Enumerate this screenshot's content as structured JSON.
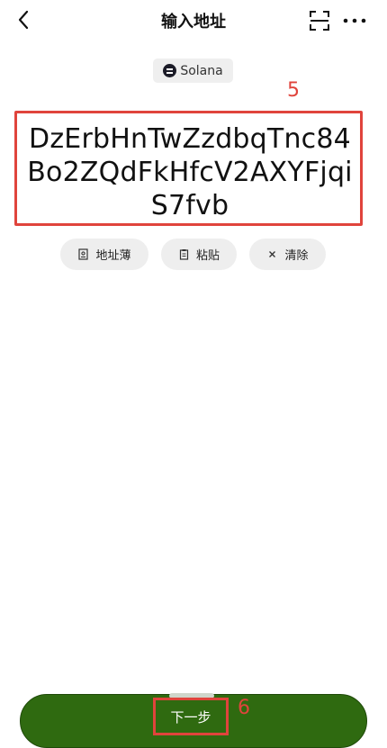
{
  "header": {
    "title": "输入地址"
  },
  "network": {
    "name": "Solana"
  },
  "address": {
    "value": "DzErbHnTwZzdbqTnc84Bo2ZQdFkHfcV2AXYFjqiS7fvb"
  },
  "actions": {
    "address_book": "地址薄",
    "paste": "粘贴",
    "clear": "清除"
  },
  "footer": {
    "next_label": "下一步"
  },
  "annotations": {
    "address_marker": "5",
    "next_marker": "6"
  },
  "colors": {
    "accent_green": "#2f6a10",
    "annotation_red": "#e0443c"
  }
}
